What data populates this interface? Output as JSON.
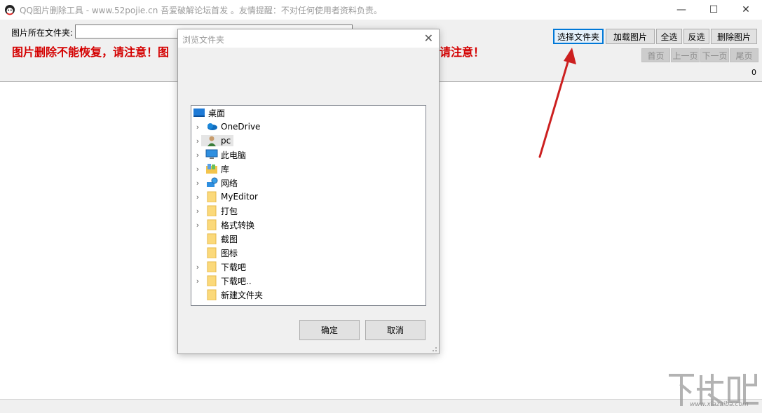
{
  "window": {
    "title": "QQ图片删除工具 - www.52pojie.cn 吾爱破解论坛首发 。友情提醒：不对任何使用者资料负责。",
    "minimize": "—",
    "maximize": "☐",
    "close": "✕"
  },
  "toolbar": {
    "folder_label": "图片所在文件夹:",
    "folder_value": "",
    "warning_left": "图片删除不能恢复，请注意！图",
    "warning_right": "请注意！",
    "select_folder": "选择文件夹",
    "load_images": "加载图片",
    "select_all": "全选",
    "invert": "反选",
    "delete_images": "删除图片",
    "first_page": "首页",
    "prev_page": "上一页",
    "next_page": "下一页",
    "last_page": "尾页",
    "count": "0"
  },
  "dialog": {
    "title": "浏览文件夹",
    "close": "✕",
    "ok": "确定",
    "cancel": "取消",
    "tree": [
      {
        "label": "桌面",
        "icon": "desktop-icon",
        "expandable": false,
        "indent": 0
      },
      {
        "label": "OneDrive",
        "icon": "cloud-icon",
        "expandable": true,
        "indent": 1
      },
      {
        "label": "pc",
        "icon": "user-icon",
        "expandable": true,
        "indent": 1
      },
      {
        "label": "此电脑",
        "icon": "computer-icon",
        "expandable": true,
        "indent": 1
      },
      {
        "label": "库",
        "icon": "library-icon",
        "expandable": true,
        "indent": 1
      },
      {
        "label": "网络",
        "icon": "network-icon",
        "expandable": true,
        "indent": 1
      },
      {
        "label": "MyEditor",
        "icon": "folder-icon",
        "expandable": true,
        "indent": 1
      },
      {
        "label": "打包",
        "icon": "folder-icon",
        "expandable": true,
        "indent": 1
      },
      {
        "label": "格式转换",
        "icon": "folder-icon",
        "expandable": true,
        "indent": 1
      },
      {
        "label": "截图",
        "icon": "folder-icon",
        "expandable": false,
        "indent": 1
      },
      {
        "label": "图标",
        "icon": "folder-icon",
        "expandable": false,
        "indent": 1
      },
      {
        "label": "下载吧",
        "icon": "folder-icon",
        "expandable": true,
        "indent": 1
      },
      {
        "label": "下载吧..",
        "icon": "folder-icon",
        "expandable": true,
        "indent": 1
      },
      {
        "label": "新建文件夹",
        "icon": "folder-icon",
        "expandable": false,
        "indent": 1
      }
    ]
  },
  "watermark": {
    "logo_text": "下载吧",
    "url": "www.xiazaiba.com"
  },
  "colors": {
    "warning": "#d40000",
    "arrow": "#cc1f1f",
    "accent": "#0078d7"
  }
}
